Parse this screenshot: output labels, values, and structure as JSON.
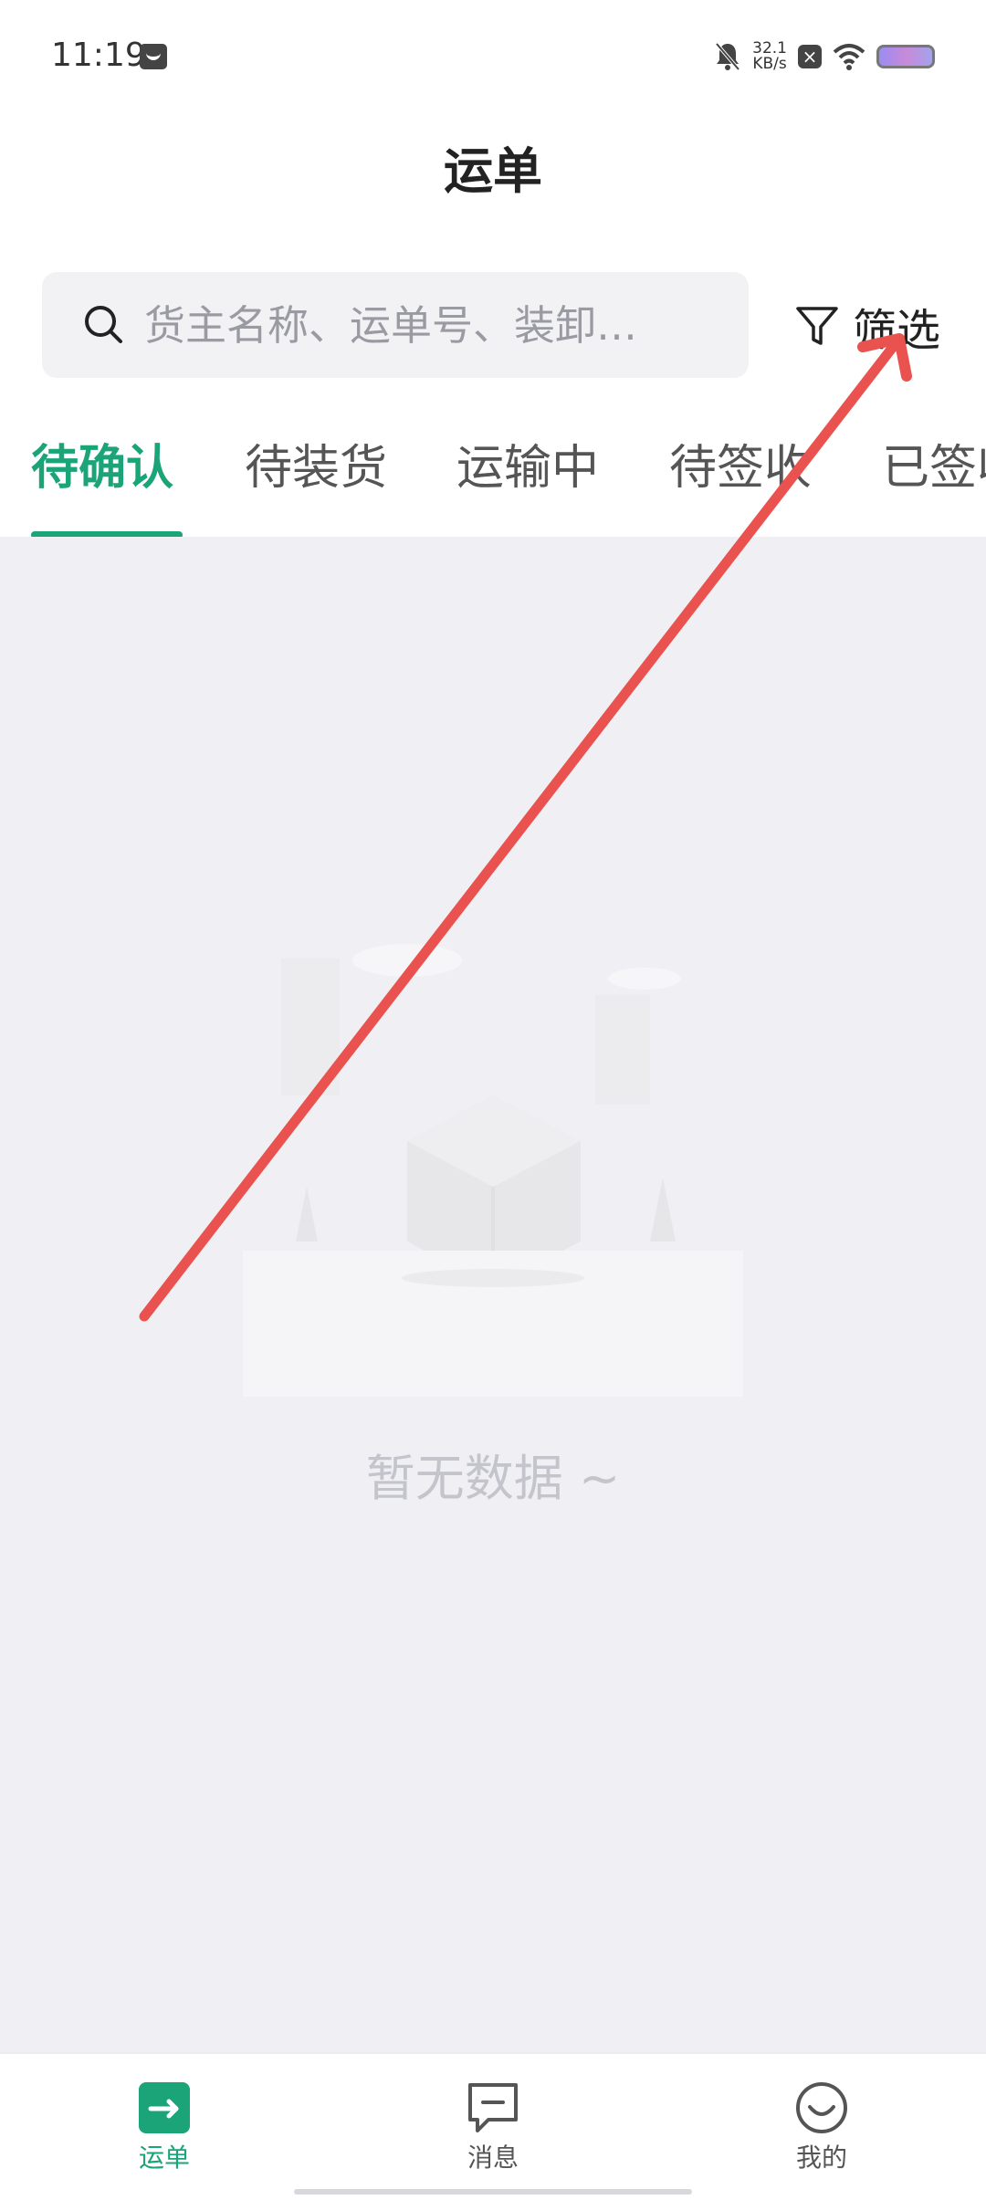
{
  "status_bar": {
    "time": "11:19",
    "net_speed_value": "32.1",
    "net_speed_unit": "KB/s"
  },
  "header": {
    "title": "运单"
  },
  "search": {
    "placeholder": "货主名称、运单号、装卸…",
    "value": ""
  },
  "filter": {
    "label": "筛选"
  },
  "tabs": [
    {
      "label": "待确认",
      "active": true
    },
    {
      "label": "待装货",
      "active": false
    },
    {
      "label": "运输中",
      "active": false
    },
    {
      "label": "待签收",
      "active": false
    },
    {
      "label": "已签收",
      "active": false
    }
  ],
  "content": {
    "empty_text": "暂无数据 ~"
  },
  "bottom_nav": {
    "items": [
      {
        "label": "运单",
        "icon": "waybill-icon",
        "active": true
      },
      {
        "label": "消息",
        "icon": "message-icon",
        "active": false
      },
      {
        "label": "我的",
        "icon": "profile-icon",
        "active": false
      }
    ]
  },
  "colors": {
    "accent": "#1aa477",
    "annotation_arrow": "#e9524f",
    "content_bg": "#f0f0f4"
  }
}
